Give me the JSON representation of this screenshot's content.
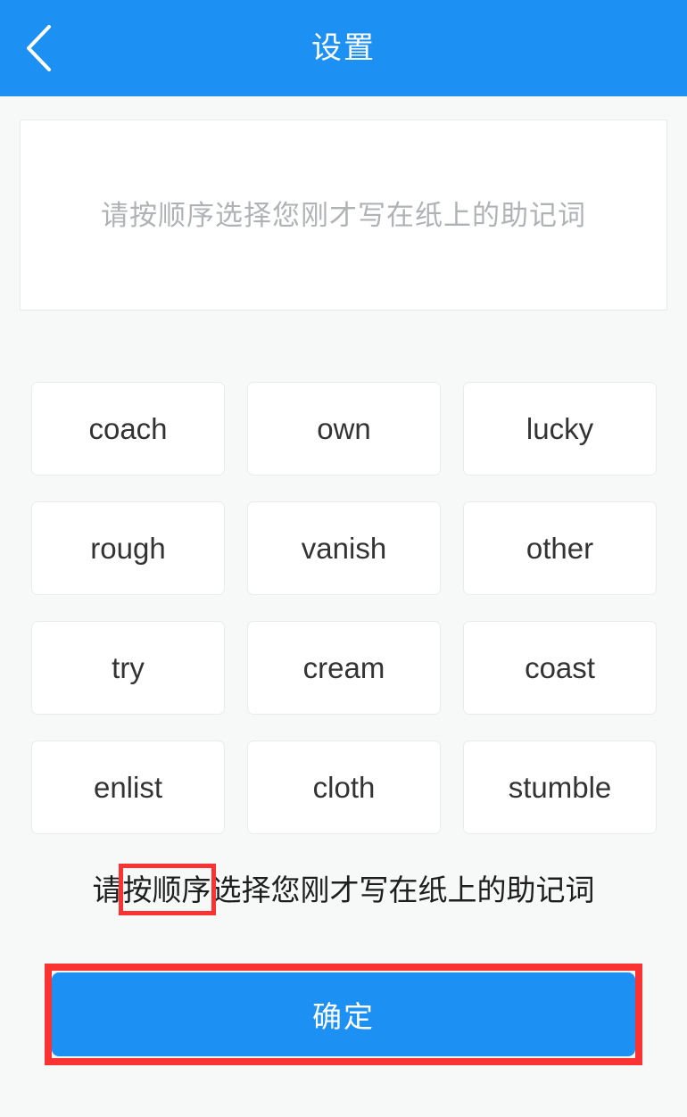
{
  "header": {
    "title": "设置",
    "back_icon": "chevron-left-icon",
    "background_color": "#1c90f3"
  },
  "answer_box": {
    "value": "",
    "placeholder": "请按顺序选择您刚才写在纸上的助记词"
  },
  "word_grid": {
    "words": [
      "coach",
      "own",
      "lucky",
      "rough",
      "vanish",
      "other",
      "try",
      "cream",
      "coast",
      "enlist",
      "cloth",
      "stumble"
    ]
  },
  "hint": {
    "prefix": "请",
    "highlighted": "按顺序",
    "suffix": "选择您刚才写在纸上的助记词",
    "full_text": "请按顺序选择您刚才写在纸上的助记词",
    "highlight_color": "#fa3232"
  },
  "confirm": {
    "label": "确定",
    "background_color": "#1c90f3",
    "annotation_color": "#fa3232"
  },
  "colors": {
    "page_background": "#f7f8f8",
    "card_background": "#ffffff",
    "card_border": "#eaebec",
    "word_text": "#333333",
    "placeholder_text": "#b0b3b5",
    "hint_text": "#1e1e1e"
  }
}
